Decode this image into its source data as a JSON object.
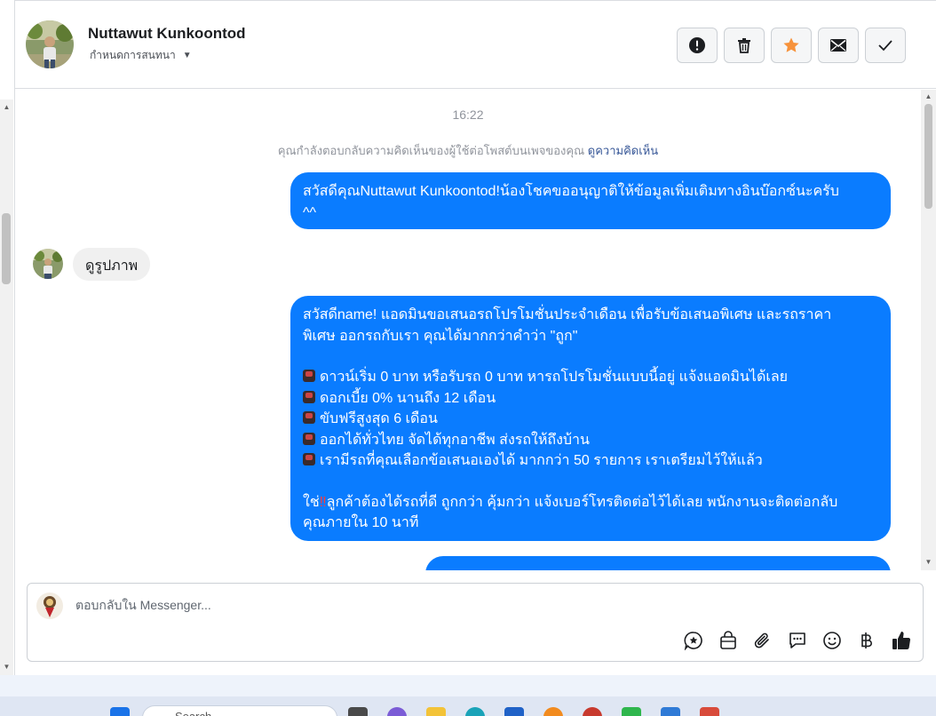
{
  "header": {
    "name": "Nuttawut Kunkoontod",
    "subtitle": "กำหนดการสนทนา"
  },
  "actions": [
    {
      "name": "report-button",
      "icon": "alert-circle-icon"
    },
    {
      "name": "delete-button",
      "icon": "trash-icon"
    },
    {
      "name": "star-button",
      "icon": "star-icon",
      "color": "#f7923b"
    },
    {
      "name": "email-button",
      "icon": "envelope-icon"
    },
    {
      "name": "done-button",
      "icon": "check-icon"
    }
  ],
  "chat": {
    "time": "16:22",
    "notice_text": "คุณกำลังตอบกลับความคิดเห็นของผู้ใช้ต่อโพสต์บนเพจของคุณ",
    "notice_link": "ดูความคิดเห็น",
    "message1_line1": "สวัสดีคุณNuttawut Kunkoontod!น้องโชคขออนุญาติให้ข้อมูลเพิ่มเติมทางอินบ๊อกซ์นะครับ",
    "message1_line2": "^^",
    "incoming": "ดูรูปภาพ",
    "message2_line1": "สวัสดีname! แอดมินขอเสนอรถโปรโมชั่นประจำเดือน เพื่อรับข้อเสนอพิเศษ และรถราคา",
    "message2_line2": "พิเศษ ออกรถกับเรา คุณได้มากกว่าคำว่า \"ถูก\"",
    "bullets": [
      "ดาวน์เริ่ม 0 บาท หรือรับรถ 0 บาท หารถโปรโมชั่นแบบนี้อยู่ แจ้งแอดมินได้เลย",
      "ดอกเบี้ย 0% นานถึง 12 เดือน",
      "ขับฟรีสูงสุด 6 เดือน",
      "ออกได้ทั่วไทย จัดได้ทุกอาชีพ ส่งรถให้ถึงบ้าน",
      "เรามีรถที่คุณเลือกข้อเสนอเองได้ มากกว่า 50 รายการ เราเตรียมไว้ให้แล้ว"
    ],
    "closing_prefix": "ใช่",
    "closing_exclaim": "‼",
    "closing_line1": "ลูกค้าต้องได้รถที่ดี ถูกกว่า คุ้มกว่า แจ้งเบอร์โทรติดต่อไว้ได้เลย พนักงานจะติดต่อกลับ",
    "closing_line2": "คุณภายใน 10 นาที",
    "bubble_color": "#0a7cff"
  },
  "composer": {
    "placeholder": "ตอบกลับใน Messenger...",
    "tools": [
      "saved-reply-icon",
      "shop-bag-icon",
      "attach-icon",
      "chat-bubble-icon",
      "emoji-icon",
      "baht-icon",
      "like-icon"
    ]
  },
  "taskbar": {
    "search_placeholder": "Search"
  }
}
